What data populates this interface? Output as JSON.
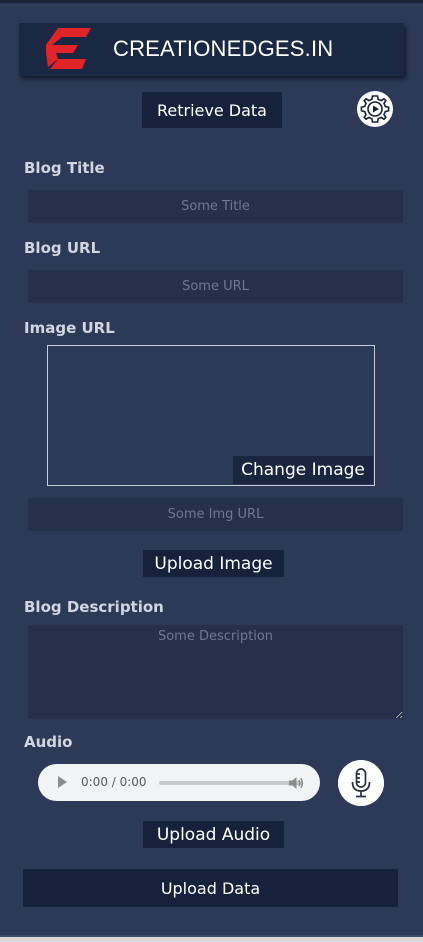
{
  "header": {
    "brand": "CREATIONEDGES.IN"
  },
  "toolbar": {
    "retrieve_label": "Retrieve Data"
  },
  "fields": {
    "blog_title": {
      "label": "Blog Title",
      "placeholder": "Some Title",
      "value": ""
    },
    "blog_url": {
      "label": "Blog URL",
      "placeholder": "Some URL",
      "value": ""
    },
    "image_url": {
      "label": "Image URL",
      "placeholder": "Some Img URL",
      "value": "",
      "change_label": "Change Image",
      "upload_label": "Upload Image"
    },
    "blog_description": {
      "label": "Blog Description",
      "placeholder": "Some Description",
      "value": ""
    },
    "audio": {
      "label": "Audio",
      "time": "0:00 / 0:00",
      "upload_label": "Upload Audio"
    }
  },
  "submit": {
    "label": "Upload Data"
  },
  "icons": {
    "logo": "logo-e-icon",
    "settings": "gear-play-icon",
    "play": "play-icon",
    "volume": "volume-icon",
    "mic": "microphone-icon"
  },
  "colors": {
    "background": "#2c3a58",
    "header": "#1b2844",
    "button": "#16223c",
    "input": "#25314b",
    "logo_red": "#e0242a"
  }
}
